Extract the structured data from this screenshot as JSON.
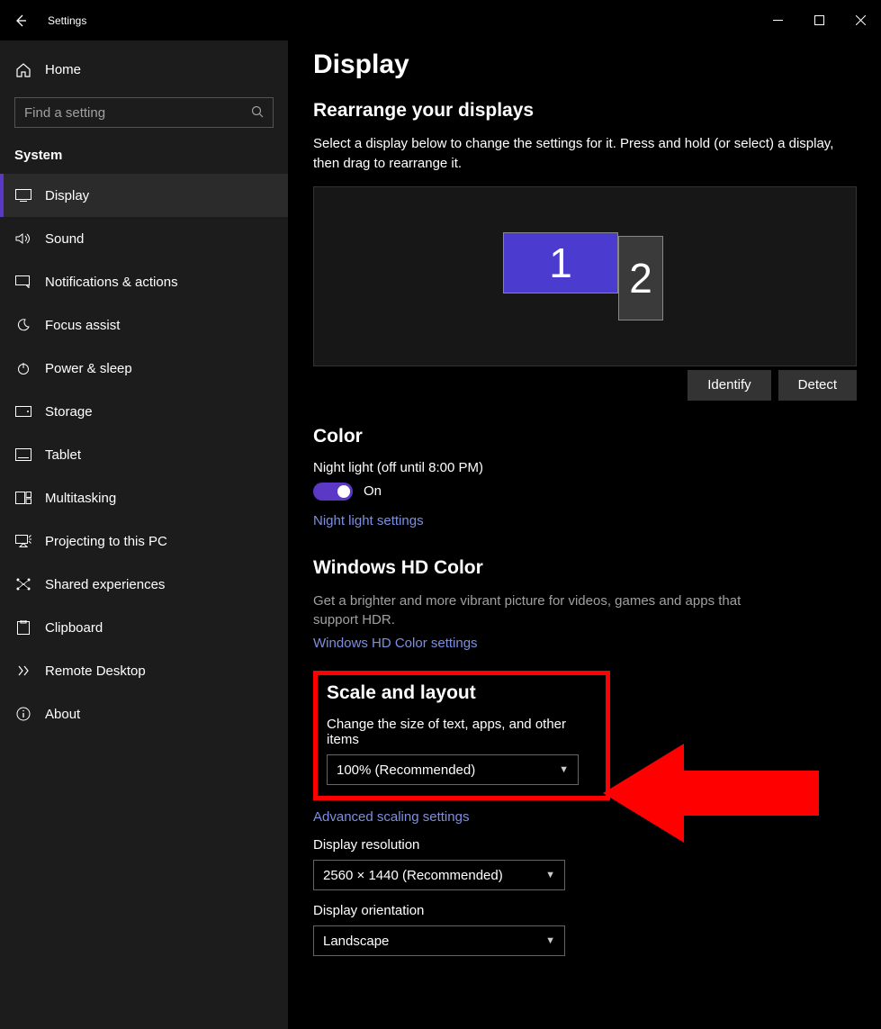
{
  "titlebar": {
    "title": "Settings"
  },
  "sidebar": {
    "home": "Home",
    "search_placeholder": "Find a setting",
    "section": "System",
    "items": [
      {
        "key": "display",
        "label": "Display",
        "active": true
      },
      {
        "key": "sound",
        "label": "Sound"
      },
      {
        "key": "notifications",
        "label": "Notifications & actions"
      },
      {
        "key": "focus",
        "label": "Focus assist"
      },
      {
        "key": "power",
        "label": "Power & sleep"
      },
      {
        "key": "storage",
        "label": "Storage"
      },
      {
        "key": "tablet",
        "label": "Tablet"
      },
      {
        "key": "multitasking",
        "label": "Multitasking"
      },
      {
        "key": "projecting",
        "label": "Projecting to this PC"
      },
      {
        "key": "shared",
        "label": "Shared experiences"
      },
      {
        "key": "clipboard",
        "label": "Clipboard"
      },
      {
        "key": "remote",
        "label": "Remote Desktop"
      },
      {
        "key": "about",
        "label": "About"
      }
    ]
  },
  "main": {
    "page_title": "Display",
    "rearrange": {
      "title": "Rearrange your displays",
      "desc": "Select a display below to change the settings for it. Press and hold (or select) a display, then drag to rearrange it.",
      "monitor1": "1",
      "monitor2": "2",
      "identify": "Identify",
      "detect": "Detect"
    },
    "color": {
      "title": "Color",
      "night_label": "Night light (off until 8:00 PM)",
      "toggle_state": "On",
      "link": "Night light settings"
    },
    "hd": {
      "title": "Windows HD Color",
      "desc": "Get a brighter and more vibrant picture for videos, games and apps that support HDR.",
      "link": "Windows HD Color settings"
    },
    "scale": {
      "title": "Scale and layout",
      "label": "Change the size of text, apps, and other items",
      "value": "100% (Recommended)",
      "link": "Advanced scaling settings"
    },
    "resolution": {
      "label": "Display resolution",
      "value": "2560 × 1440 (Recommended)"
    },
    "orientation": {
      "label": "Display orientation",
      "value": "Landscape"
    }
  }
}
